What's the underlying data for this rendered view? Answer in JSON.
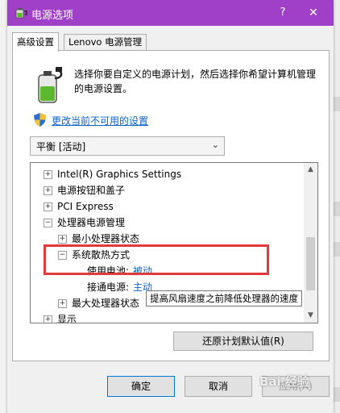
{
  "window": {
    "title": "电源选项",
    "help": "?",
    "close": "✕"
  },
  "tabs": [
    {
      "label": "高级设置"
    },
    {
      "label": "Lenovo 电源管理"
    }
  ],
  "intro_text": "选择你要自定义的电源计划，然后选择你希望计算机管理的电源设置。",
  "change_link": "更改当前不可用的设置",
  "plan_select": {
    "value": "平衡 [活动]"
  },
  "tree": [
    {
      "label": "Intel(R) Graphics Settings",
      "expander": "+"
    },
    {
      "label": "电源按钮和盖子",
      "expander": "+"
    },
    {
      "label": "PCI Express",
      "expander": "+"
    },
    {
      "label": "处理器电源管理",
      "expander": "−"
    },
    {
      "label": "最小处理器状态",
      "expander": "+"
    },
    {
      "label": "系统散热方式",
      "expander": "−"
    },
    {
      "label": "使用电池:",
      "value": "被动"
    },
    {
      "label": "接通电源:",
      "value": "主动"
    },
    {
      "label": "最大处理器状态",
      "expander": "+"
    },
    {
      "label": "显示",
      "expander": "+"
    }
  ],
  "tooltip": "提高风扇速度之前降低处理器的速度",
  "restore_button": "还原计划默认值(R)",
  "buttons": {
    "ok": "确定",
    "cancel": "取消",
    "apply": "应用(A)"
  },
  "watermark": "Bai 经验",
  "colors": {
    "titlebar": "#a03fc7",
    "link": "#0c63c6",
    "highlight": "#e03a3a"
  },
  "icons": {
    "title": "power-options-icon",
    "battery": "battery-plug-icon",
    "shield": "uac-shield-icon"
  }
}
